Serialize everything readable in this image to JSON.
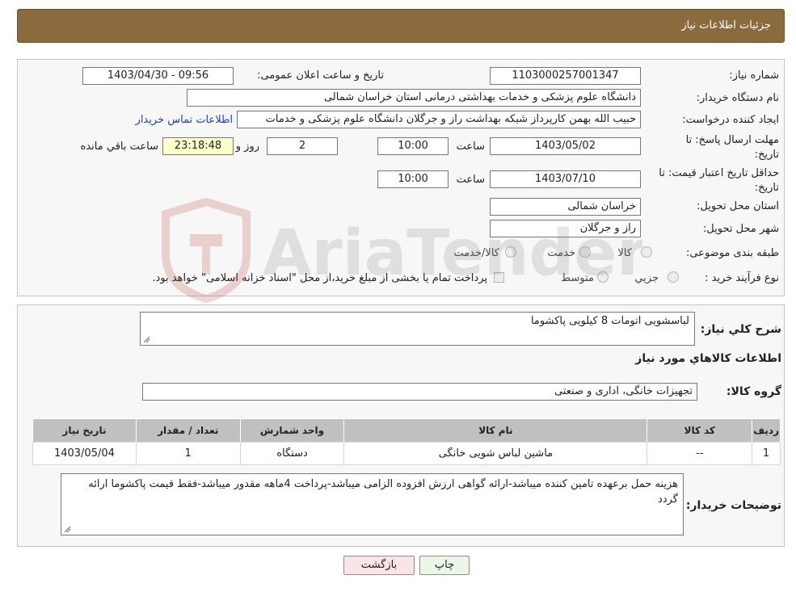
{
  "header": {
    "title": "جزئیات اطلاعات نیاز"
  },
  "form": {
    "need_number_label": "شماره نیاز:",
    "need_number": "1103000257001347",
    "announce_label": "تاریخ و ساعت اعلان عمومی:",
    "announce_value": "1403/04/30 - 09:56",
    "buyer_label": "نام دستگاه خریدار:",
    "buyer_value": "دانشگاه علوم پزشکی و خدمات بهداشتی درمانی استان خراسان شمالی",
    "requester_label": "ایجاد کننده درخواست:",
    "requester_value": "حبیب الله بهمن کارپرداز شبکه بهداشت راز و جرگلان دانشگاه علوم پزشکی و خدمات",
    "contact_link": "اطلاعات تماس خریدار",
    "deadline_label_1": "مهلت ارسال پاسخ: تا",
    "deadline_label_2": "تاریخ:",
    "deadline_date": "1403/05/02",
    "time_label": "ساعت",
    "deadline_time": "10:00",
    "days_value": "2",
    "days_label": "روز و",
    "remaining_time": "23:18:48",
    "remaining_label": "ساعت باقي مانده",
    "validity_label_1": "حداقل تاریخ اعتبار قیمت: تا",
    "validity_label_2": "تاریخ:",
    "validity_date": "1403/07/10",
    "validity_time_label": "ساعت",
    "validity_time": "10:00",
    "province_label": "استان محل تحویل:",
    "province_value": "خراسان شمالی",
    "city_label": "شهر محل تحویل:",
    "city_value": "راز و جرگلان",
    "category_label": "طبقه بندی موضوعی:",
    "category_options": [
      "کالا",
      "خدمت",
      "کالا/خدمت"
    ],
    "purchase_label": "نوع فرآیند خرید :",
    "purchase_options": [
      "جزیي",
      "متوسط"
    ],
    "purchase_note": "پرداخت تمام یا بخشی از مبلغ خرید،از محل \"اسناد خزانه اسلامی\" خواهد بود."
  },
  "details": {
    "summary_label": "شرح کلي نياز:",
    "summary_value": "لباسشویی اتومات 8 کیلویی پاکشوما",
    "items_heading": "اطلاعات کالاهاي مورد نياز",
    "group_label": "گروه کالا:",
    "group_value": "تجهیزات خانگی، اداری و صنعتی",
    "table": {
      "headers": [
        "رديف",
        "کد کالا",
        "نام کالا",
        "واحد شمارش",
        "تعداد / مقدار",
        "تاريخ نياز"
      ],
      "rows": [
        [
          "1",
          "--",
          "ماشین لباس شویی خانگی",
          "دستگاه",
          "1",
          "1403/05/04"
        ]
      ]
    },
    "notes_label": "توضیحات خریدار:",
    "notes_value": "هزینه حمل برعهده تامین کننده میباشد-ارائه گواهی ارزش افزوده الزامی میباشد-پرداخت 4ماهه مقدور میباشد-فقط قیمت پاکشوما ارائه گردد"
  },
  "buttons": {
    "print": "چاپ",
    "back": "بازگشت"
  },
  "watermark": {
    "text": "AriaTender.neT"
  },
  "colors": {
    "header": "#8b6b3e",
    "link": "#1a3fd0",
    "print_bg": "#eaf7e6",
    "back_bg": "#fbe4e4"
  }
}
